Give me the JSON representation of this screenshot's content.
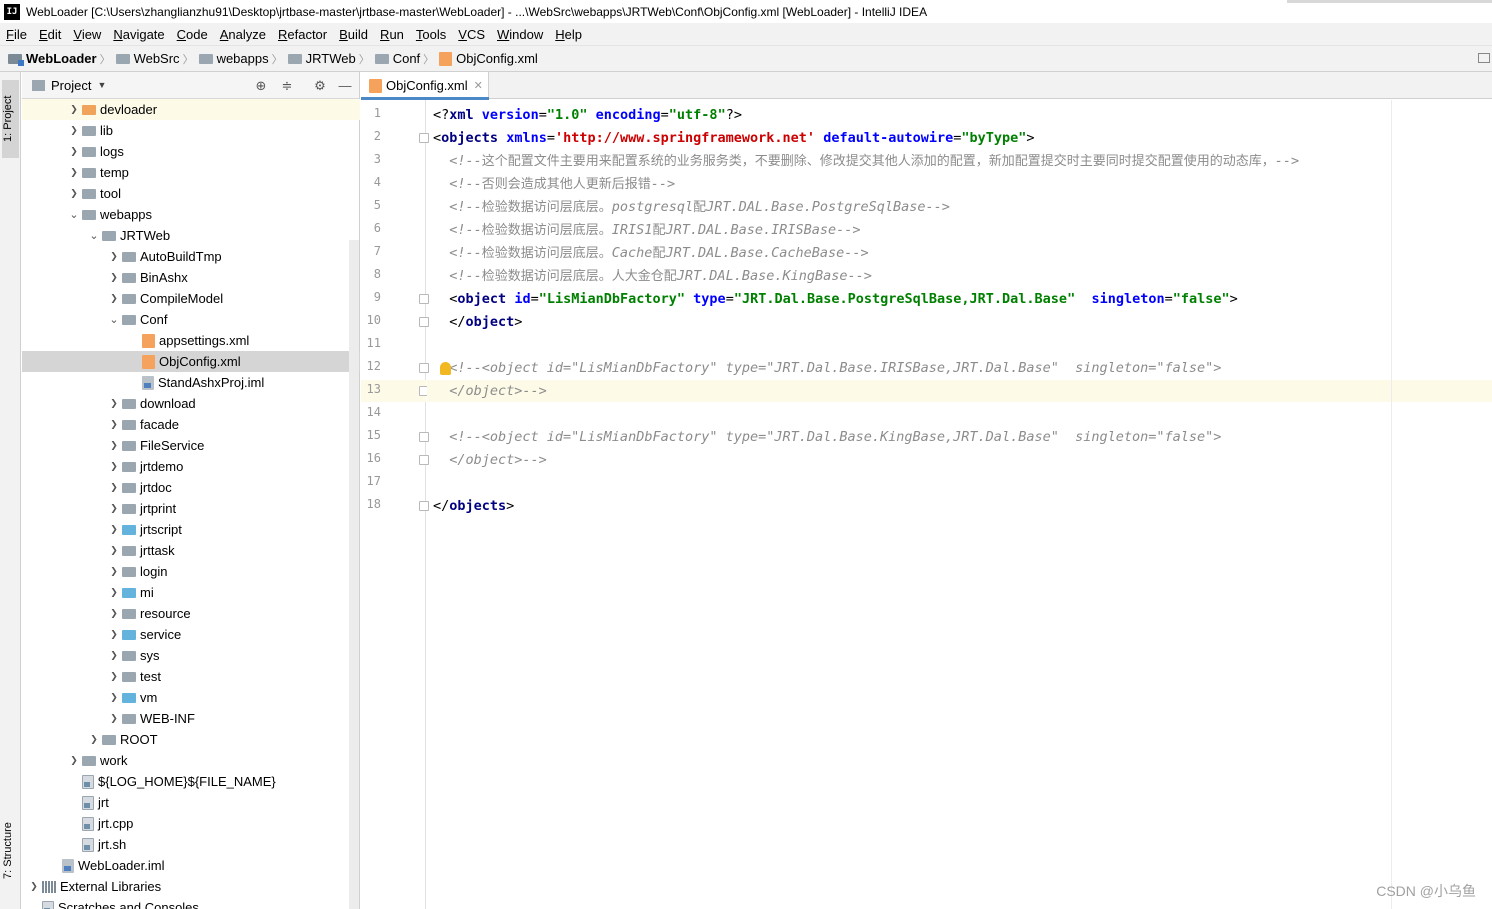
{
  "window": {
    "title": "WebLoader [C:\\Users\\zhanglianzhu91\\Desktop\\jrtbase-master\\jrtbase-master\\WebLoader] - ...\\WebSrc\\webapps\\JRTWeb\\Conf\\ObjConfig.xml [WebLoader] - IntelliJ IDEA",
    "logo": "IJ"
  },
  "menu": [
    "File",
    "Edit",
    "View",
    "Navigate",
    "Code",
    "Analyze",
    "Refactor",
    "Build",
    "Run",
    "Tools",
    "VCS",
    "Window",
    "Help"
  ],
  "breadcrumbs": [
    "WebLoader",
    "WebSrc",
    "webapps",
    "JRTWeb",
    "Conf",
    "ObjConfig.xml"
  ],
  "left_strip": {
    "project_tab": "1: Project",
    "structure_tab": "7: Structure"
  },
  "project_panel": {
    "title": "Project"
  },
  "tree": [
    {
      "label": "devloader",
      "depth": 2,
      "kind": "folder-orange",
      "arrow": "›"
    },
    {
      "label": "lib",
      "depth": 2,
      "kind": "folder",
      "arrow": "›"
    },
    {
      "label": "logs",
      "depth": 2,
      "kind": "folder",
      "arrow": "›"
    },
    {
      "label": "temp",
      "depth": 2,
      "kind": "folder",
      "arrow": "›"
    },
    {
      "label": "tool",
      "depth": 2,
      "kind": "folder",
      "arrow": "›"
    },
    {
      "label": "webapps",
      "depth": 2,
      "kind": "folder",
      "arrow": "⌄"
    },
    {
      "label": "JRTWeb",
      "depth": 3,
      "kind": "folder",
      "arrow": "⌄"
    },
    {
      "label": "AutoBuildTmp",
      "depth": 4,
      "kind": "folder",
      "arrow": "›"
    },
    {
      "label": "BinAshx",
      "depth": 4,
      "kind": "folder",
      "arrow": "›"
    },
    {
      "label": "CompileModel",
      "depth": 4,
      "kind": "folder",
      "arrow": "›"
    },
    {
      "label": "Conf",
      "depth": 4,
      "kind": "folder",
      "arrow": "⌄"
    },
    {
      "label": "appsettings.xml",
      "depth": 5,
      "kind": "xml",
      "arrow": ""
    },
    {
      "label": "ObjConfig.xml",
      "depth": 5,
      "kind": "xml",
      "arrow": "",
      "selected": true
    },
    {
      "label": "StandAshxProj.iml",
      "depth": 5,
      "kind": "iml",
      "arrow": ""
    },
    {
      "label": "download",
      "depth": 4,
      "kind": "folder",
      "arrow": "›"
    },
    {
      "label": "facade",
      "depth": 4,
      "kind": "folder",
      "arrow": "›"
    },
    {
      "label": "FileService",
      "depth": 4,
      "kind": "folder",
      "arrow": "›"
    },
    {
      "label": "jrtdemo",
      "depth": 4,
      "kind": "folder",
      "arrow": "›"
    },
    {
      "label": "jrtdoc",
      "depth": 4,
      "kind": "folder",
      "arrow": "›"
    },
    {
      "label": "jrtprint",
      "depth": 4,
      "kind": "folder",
      "arrow": "›"
    },
    {
      "label": "jrtscript",
      "depth": 4,
      "kind": "folder-blue",
      "arrow": "›"
    },
    {
      "label": "jrttask",
      "depth": 4,
      "kind": "folder",
      "arrow": "›"
    },
    {
      "label": "login",
      "depth": 4,
      "kind": "folder",
      "arrow": "›"
    },
    {
      "label": "mi",
      "depth": 4,
      "kind": "folder-blue",
      "arrow": "›"
    },
    {
      "label": "resource",
      "depth": 4,
      "kind": "folder",
      "arrow": "›"
    },
    {
      "label": "service",
      "depth": 4,
      "kind": "folder-blue",
      "arrow": "›"
    },
    {
      "label": "sys",
      "depth": 4,
      "kind": "folder",
      "arrow": "›"
    },
    {
      "label": "test",
      "depth": 4,
      "kind": "folder",
      "arrow": "›"
    },
    {
      "label": "vm",
      "depth": 4,
      "kind": "folder-blue",
      "arrow": "›"
    },
    {
      "label": "WEB-INF",
      "depth": 4,
      "kind": "folder",
      "arrow": "›"
    },
    {
      "label": "ROOT",
      "depth": 3,
      "kind": "folder",
      "arrow": "›"
    },
    {
      "label": "work",
      "depth": 2,
      "kind": "folder",
      "arrow": "›"
    },
    {
      "label": "${LOG_HOME}${FILE_NAME}",
      "depth": 2,
      "kind": "file",
      "arrow": ""
    },
    {
      "label": "jrt",
      "depth": 2,
      "kind": "file",
      "arrow": ""
    },
    {
      "label": "jrt.cpp",
      "depth": 2,
      "kind": "file",
      "arrow": ""
    },
    {
      "label": "jrt.sh",
      "depth": 2,
      "kind": "file",
      "arrow": ""
    },
    {
      "label": "WebLoader.iml",
      "depth": 1,
      "kind": "iml",
      "arrow": ""
    },
    {
      "label": "External Libraries",
      "depth": 0,
      "kind": "lib",
      "arrow": "›"
    },
    {
      "label": "Scratches and Consoles",
      "depth": 0,
      "kind": "file",
      "arrow": ""
    }
  ],
  "editor": {
    "tab": "ObjConfig.xml",
    "current_line": 13,
    "lines": [
      [
        {
          "t": "<?",
          "c": "pi"
        },
        {
          "t": "xml",
          "c": "tag"
        },
        {
          "t": " ",
          "c": "t"
        },
        {
          "t": "version",
          "c": "attr"
        },
        {
          "t": "=",
          "c": "t"
        },
        {
          "t": "\"1.0\"",
          "c": "val"
        },
        {
          "t": " ",
          "c": "t"
        },
        {
          "t": "encoding",
          "c": "attr"
        },
        {
          "t": "=",
          "c": "t"
        },
        {
          "t": "\"utf-8\"",
          "c": "val"
        },
        {
          "t": "?>",
          "c": "pi"
        }
      ],
      [
        {
          "t": "<",
          "c": "br"
        },
        {
          "t": "objects",
          "c": "tag"
        },
        {
          "t": " ",
          "c": "t"
        },
        {
          "t": "xmlns",
          "c": "attr"
        },
        {
          "t": "=",
          "c": "t"
        },
        {
          "t": "'http://www.springframework.net'",
          "c": "url"
        },
        {
          "t": " ",
          "c": "t"
        },
        {
          "t": "default-autowire",
          "c": "attr"
        },
        {
          "t": "=",
          "c": "t"
        },
        {
          "t": "\"byType\"",
          "c": "val"
        },
        {
          "t": ">",
          "c": "br"
        }
      ],
      [
        {
          "t": "  <!--",
          "c": "cm"
        },
        {
          "t": "这个配置文件主要用来配置系统的业务服务类，不要删除、修改提交其他人添加的配置，新加配置提交时主要同时提交配置使用的动态库，",
          "c": "cmz"
        },
        {
          "t": "-->",
          "c": "cm"
        }
      ],
      [
        {
          "t": "  <!--",
          "c": "cm"
        },
        {
          "t": "否则会造成其他人更新后报错",
          "c": "cmz"
        },
        {
          "t": "-->",
          "c": "cm"
        }
      ],
      [
        {
          "t": "  <!--",
          "c": "cm"
        },
        {
          "t": "检验数据访问层底层。",
          "c": "cmz"
        },
        {
          "t": "postgresql",
          "c": "cm"
        },
        {
          "t": "配",
          "c": "cmz"
        },
        {
          "t": "JRT.DAL.Base.PostgreSqlBase-->",
          "c": "cm"
        }
      ],
      [
        {
          "t": "  <!--",
          "c": "cm"
        },
        {
          "t": "检验数据访问层底层。",
          "c": "cmz"
        },
        {
          "t": "IRIS1",
          "c": "cm"
        },
        {
          "t": "配",
          "c": "cmz"
        },
        {
          "t": "JRT.DAL.Base.IRISBase-->",
          "c": "cm"
        }
      ],
      [
        {
          "t": "  <!--",
          "c": "cm"
        },
        {
          "t": "检验数据访问层底层。",
          "c": "cmz"
        },
        {
          "t": "Cache",
          "c": "cm"
        },
        {
          "t": "配",
          "c": "cmz"
        },
        {
          "t": "JRT.DAL.Base.CacheBase-->",
          "c": "cm"
        }
      ],
      [
        {
          "t": "  <!--",
          "c": "cm"
        },
        {
          "t": "检验数据访问层底层。人大金仓配",
          "c": "cmz"
        },
        {
          "t": "JRT.DAL.Base.KingBase-->",
          "c": "cm"
        }
      ],
      [
        {
          "t": "  <",
          "c": "br"
        },
        {
          "t": "object",
          "c": "tag"
        },
        {
          "t": " ",
          "c": "t"
        },
        {
          "t": "id",
          "c": "attr"
        },
        {
          "t": "=",
          "c": "t"
        },
        {
          "t": "\"LisMianDbFactory\"",
          "c": "val"
        },
        {
          "t": " ",
          "c": "t"
        },
        {
          "t": "type",
          "c": "attr"
        },
        {
          "t": "=",
          "c": "t"
        },
        {
          "t": "\"JRT.Dal.Base.PostgreSqlBase,JRT.Dal.Base\"",
          "c": "val"
        },
        {
          "t": "  ",
          "c": "t"
        },
        {
          "t": "singleton",
          "c": "attr"
        },
        {
          "t": "=",
          "c": "t"
        },
        {
          "t": "\"false\"",
          "c": "val"
        },
        {
          "t": ">",
          "c": "br"
        }
      ],
      [
        {
          "t": "  </",
          "c": "br"
        },
        {
          "t": "object",
          "c": "tag"
        },
        {
          "t": ">",
          "c": "br"
        }
      ],
      [],
      [
        {
          "t": "  <!--<object id=\"LisMianDbFactory\" type=\"JRT.Dal.Base.IRISBase,JRT.Dal.Base\"  singleton=\"false\">",
          "c": "cm"
        }
      ],
      [
        {
          "t": "  </object>-->",
          "c": "cm"
        }
      ],
      [],
      [
        {
          "t": "  <!--<object id=\"LisMianDbFactory\" type=\"JRT.Dal.Base.KingBase,JRT.Dal.Base\"  singleton=\"false\">",
          "c": "cm"
        }
      ],
      [
        {
          "t": "  </object>-->",
          "c": "cm"
        }
      ],
      [],
      [
        {
          "t": "</",
          "c": "br"
        },
        {
          "t": "objects",
          "c": "tag"
        },
        {
          "t": ">",
          "c": "br"
        }
      ]
    ]
  },
  "watermark": "CSDN @小乌鱼"
}
